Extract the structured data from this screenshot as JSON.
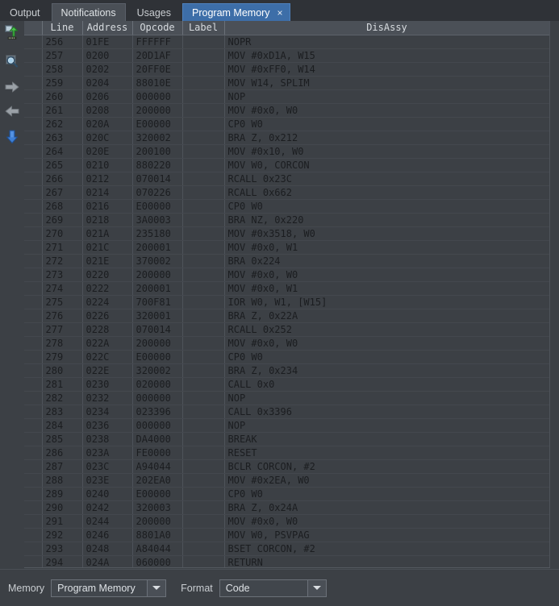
{
  "window": {
    "title": "Program Memory"
  },
  "tabs": [
    {
      "label": "Output",
      "state": "normal",
      "closable": false
    },
    {
      "label": "Notifications",
      "state": "hover",
      "closable": false
    },
    {
      "label": "Usages",
      "state": "normal",
      "closable": false
    },
    {
      "label": "Program Memory",
      "state": "active",
      "closable": true,
      "close_label": "×"
    }
  ],
  "toolbar": {
    "items": [
      {
        "name": "upload-to-memory-icon",
        "title": "Read Device Memory"
      },
      {
        "name": "search-icon",
        "title": "Find"
      },
      {
        "name": "arrow-right-icon",
        "title": "Go Forward"
      },
      {
        "name": "arrow-left-icon",
        "title": "Go Back"
      },
      {
        "name": "arrow-down-icon",
        "title": "Go To"
      }
    ]
  },
  "table": {
    "columns": [
      "Line",
      "Address",
      "Opcode",
      "Label",
      "DisAssy"
    ],
    "rows": [
      {
        "line": "256",
        "address": "01FE",
        "opcode": "FFFFFF",
        "label": "",
        "disassy": "NOPR"
      },
      {
        "line": "257",
        "address": "0200",
        "opcode": "20D1AF",
        "label": "",
        "disassy": "MOV #0xD1A, W15"
      },
      {
        "line": "258",
        "address": "0202",
        "opcode": "20FF0E",
        "label": "",
        "disassy": "MOV #0xFF0, W14"
      },
      {
        "line": "259",
        "address": "0204",
        "opcode": "88010E",
        "label": "",
        "disassy": "MOV W14, SPLIM"
      },
      {
        "line": "260",
        "address": "0206",
        "opcode": "000000",
        "label": "",
        "disassy": "NOP"
      },
      {
        "line": "261",
        "address": "0208",
        "opcode": "200000",
        "label": "",
        "disassy": "MOV #0x0, W0"
      },
      {
        "line": "262",
        "address": "020A",
        "opcode": "E00000",
        "label": "",
        "disassy": "CP0 W0"
      },
      {
        "line": "263",
        "address": "020C",
        "opcode": "320002",
        "label": "",
        "disassy": "BRA Z, 0x212"
      },
      {
        "line": "264",
        "address": "020E",
        "opcode": "200100",
        "label": "",
        "disassy": "MOV #0x10, W0"
      },
      {
        "line": "265",
        "address": "0210",
        "opcode": "880220",
        "label": "",
        "disassy": "MOV W0, CORCON"
      },
      {
        "line": "266",
        "address": "0212",
        "opcode": "070014",
        "label": "",
        "disassy": "RCALL 0x23C"
      },
      {
        "line": "267",
        "address": "0214",
        "opcode": "070226",
        "label": "",
        "disassy": "RCALL 0x662"
      },
      {
        "line": "268",
        "address": "0216",
        "opcode": "E00000",
        "label": "",
        "disassy": "CP0 W0"
      },
      {
        "line": "269",
        "address": "0218",
        "opcode": "3A0003",
        "label": "",
        "disassy": "BRA NZ, 0x220"
      },
      {
        "line": "270",
        "address": "021A",
        "opcode": "235180",
        "label": "",
        "disassy": "MOV #0x3518, W0"
      },
      {
        "line": "271",
        "address": "021C",
        "opcode": "200001",
        "label": "",
        "disassy": "MOV #0x0, W1"
      },
      {
        "line": "272",
        "address": "021E",
        "opcode": "370002",
        "label": "",
        "disassy": "BRA 0x224"
      },
      {
        "line": "273",
        "address": "0220",
        "opcode": "200000",
        "label": "",
        "disassy": "MOV #0x0, W0"
      },
      {
        "line": "274",
        "address": "0222",
        "opcode": "200001",
        "label": "",
        "disassy": "MOV #0x0, W1"
      },
      {
        "line": "275",
        "address": "0224",
        "opcode": "700F81",
        "label": "",
        "disassy": "IOR W0, W1, [W15]"
      },
      {
        "line": "276",
        "address": "0226",
        "opcode": "320001",
        "label": "",
        "disassy": "BRA Z, 0x22A"
      },
      {
        "line": "277",
        "address": "0228",
        "opcode": "070014",
        "label": "",
        "disassy": "RCALL 0x252"
      },
      {
        "line": "278",
        "address": "022A",
        "opcode": "200000",
        "label": "",
        "disassy": "MOV #0x0, W0"
      },
      {
        "line": "279",
        "address": "022C",
        "opcode": "E00000",
        "label": "",
        "disassy": "CP0 W0"
      },
      {
        "line": "280",
        "address": "022E",
        "opcode": "320002",
        "label": "",
        "disassy": "BRA Z, 0x234"
      },
      {
        "line": "281",
        "address": "0230",
        "opcode": "020000",
        "label": "",
        "disassy": "CALL 0x0"
      },
      {
        "line": "282",
        "address": "0232",
        "opcode": "000000",
        "label": "",
        "disassy": "NOP"
      },
      {
        "line": "283",
        "address": "0234",
        "opcode": "023396",
        "label": "",
        "disassy": "CALL 0x3396"
      },
      {
        "line": "284",
        "address": "0236",
        "opcode": "000000",
        "label": "",
        "disassy": "NOP"
      },
      {
        "line": "285",
        "address": "0238",
        "opcode": "DA4000",
        "label": "",
        "disassy": "BREAK"
      },
      {
        "line": "286",
        "address": "023A",
        "opcode": "FE0000",
        "label": "",
        "disassy": "RESET"
      },
      {
        "line": "287",
        "address": "023C",
        "opcode": "A94044",
        "label": "",
        "disassy": "BCLR CORCON, #2"
      },
      {
        "line": "288",
        "address": "023E",
        "opcode": "202EA0",
        "label": "",
        "disassy": "MOV #0x2EA, W0"
      },
      {
        "line": "289",
        "address": "0240",
        "opcode": "E00000",
        "label": "",
        "disassy": "CP0 W0"
      },
      {
        "line": "290",
        "address": "0242",
        "opcode": "320003",
        "label": "",
        "disassy": "BRA Z, 0x24A"
      },
      {
        "line": "291",
        "address": "0244",
        "opcode": "200000",
        "label": "",
        "disassy": "MOV #0x0, W0"
      },
      {
        "line": "292",
        "address": "0246",
        "opcode": "8801A0",
        "label": "",
        "disassy": "MOV W0, PSVPAG"
      },
      {
        "line": "293",
        "address": "0248",
        "opcode": "A84044",
        "label": "",
        "disassy": "BSET CORCON, #2"
      },
      {
        "line": "294",
        "address": "024A",
        "opcode": "060000",
        "label": "",
        "disassy": "RETURN"
      }
    ]
  },
  "statusbar": {
    "memory_label": "Memory",
    "memory_value": "Program Memory",
    "format_label": "Format",
    "format_value": "Code"
  },
  "colors": {
    "accent": "#3d6ea8",
    "chrome": "#3c4045",
    "tabbar": "#2f3237",
    "header": "#4b5057",
    "text": "#c9cdd1",
    "cell_text": "#1b1d20"
  }
}
